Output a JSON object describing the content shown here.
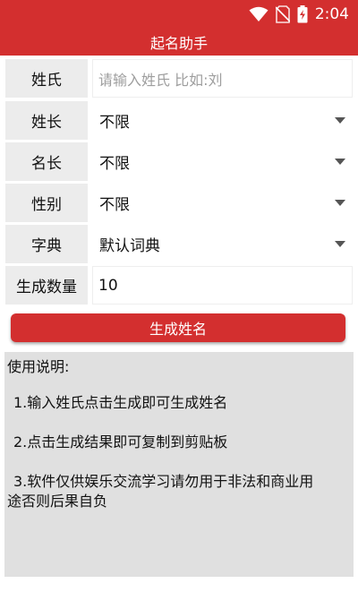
{
  "status_bar": {
    "time": "2:04"
  },
  "header": {
    "title": "起名助手"
  },
  "form": {
    "surname": {
      "label": "姓氏",
      "placeholder": "请输入姓氏 比如:刘"
    },
    "surname_length": {
      "label": "姓长",
      "value": "不限"
    },
    "name_length": {
      "label": "名长",
      "value": "不限"
    },
    "gender": {
      "label": "性别",
      "value": "不限"
    },
    "dictionary": {
      "label": "字典",
      "value": "默认词典"
    },
    "count": {
      "label": "生成数量",
      "value": "10"
    }
  },
  "button": {
    "generate_label": "生成姓名"
  },
  "instructions": {
    "title": "使用说明:",
    "item1": "1.输入姓氏点击生成即可生成姓名",
    "item2": "2.点击生成结果即可复制到剪贴板",
    "item3_line1": "3.软件仅供娱乐交流学习请勿用于非法和商业用",
    "item3_line2": "途否则后果自负"
  },
  "colors": {
    "primary": "#d32f2f",
    "label_bg": "#ececec",
    "panel_bg": "#e0e0e0"
  }
}
